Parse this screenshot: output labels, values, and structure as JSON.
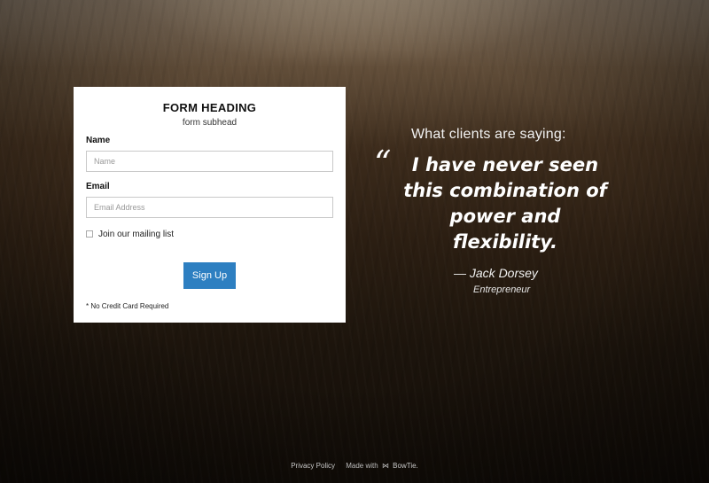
{
  "form": {
    "heading": "FORM HEADING",
    "subhead": "form subhead",
    "name_label": "Name",
    "name_placeholder": "Name",
    "name_value": "",
    "email_label": "Email",
    "email_placeholder": "Email Address",
    "email_value": "",
    "mailing_list_label": "Join our mailing list",
    "mailing_list_checked": false,
    "submit_label": "Sign Up",
    "fine_print": "* No Credit Card Required",
    "button_color": "#2d7fc1"
  },
  "testimonial": {
    "heading": "What clients are saying:",
    "quote_mark": "“",
    "quote": "I have never seen this combination of power and flexibility.",
    "author": "— Jack Dorsey",
    "author_title": "Entrepreneur"
  },
  "footer": {
    "privacy_label": "Privacy Policy",
    "made_with_label": "Made with",
    "logo_icon": "bowtie-icon",
    "logo_glyph": "⋈",
    "brand_label": "BowTie."
  }
}
